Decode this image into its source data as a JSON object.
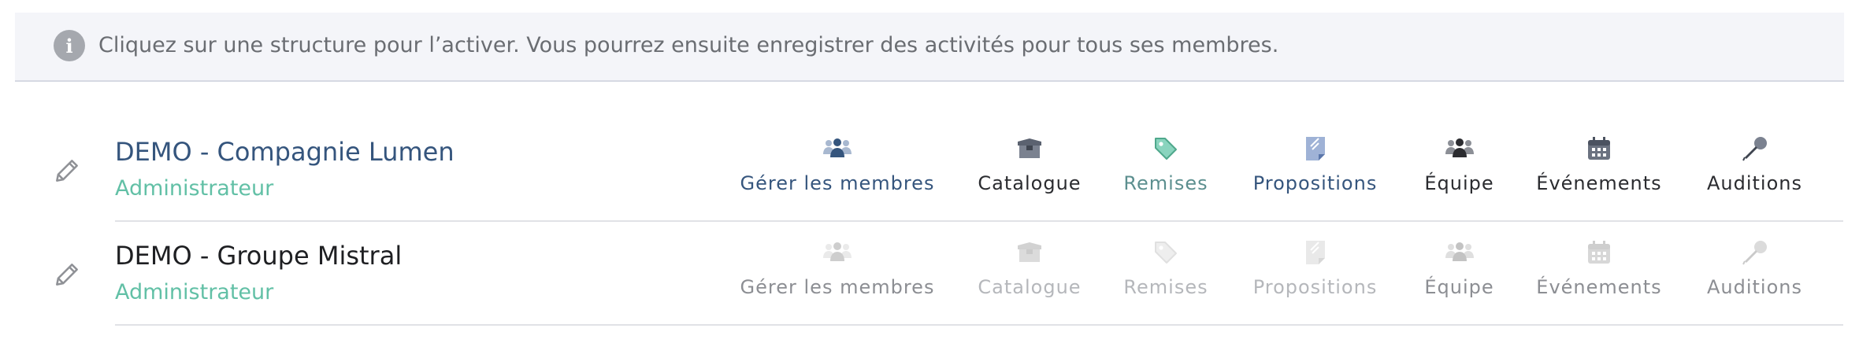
{
  "info": {
    "message": "Cliquez sur une structure pour l’activer. Vous pourrez ensuite enregistrer des activités pour tous ses membres."
  },
  "structures": [
    {
      "name": "DEMO - Compagnie Lumen",
      "role": "Administrateur",
      "active": true
    },
    {
      "name": "DEMO - Groupe Mistral",
      "role": "Administrateur",
      "active": false
    }
  ],
  "actions": {
    "members": "Gérer les membres",
    "catalog": "Catalogue",
    "discounts": "Remises",
    "proposals": "Propositions",
    "team": "Équipe",
    "events": "Événements",
    "auditions": "Auditions"
  },
  "icons": {
    "info": "info-icon",
    "edit": "pencil-icon",
    "members": "users-icon",
    "catalog": "box-icon",
    "discounts": "tag-icon",
    "proposals": "document-icon",
    "team": "team-icon",
    "events": "calendar-icon",
    "auditions": "microphone-icon"
  },
  "colors": {
    "primary": "#35557d",
    "role": "#62c0a6",
    "discounts": "#62c0a6",
    "proposals": "#8aa0c8",
    "dark": "#2b2c30",
    "disabled": "#b5b7bb"
  }
}
